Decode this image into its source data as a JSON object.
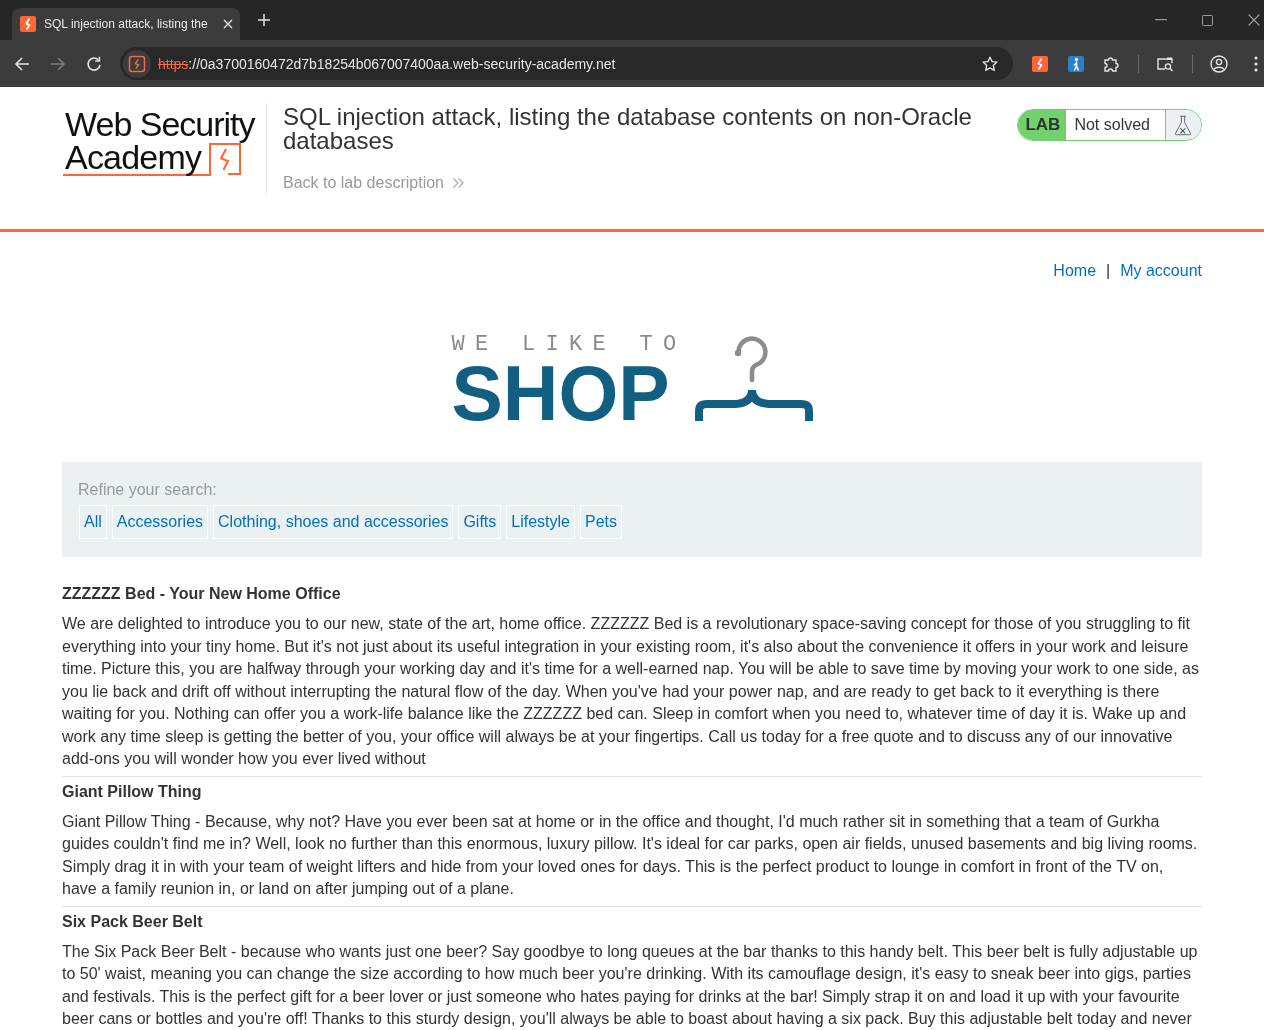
{
  "browser": {
    "tabs": [
      {
        "title": "SQL injection attack, listing the",
        "selected": true
      }
    ],
    "back_enabled": true,
    "forward_enabled": false,
    "address_bar": {
      "scheme": "https",
      "rest": "://0a3700160472d7b18254b067007400aa.web-security-academy.net",
      "not_secure": true
    }
  },
  "header": {
    "logo": {
      "line_1": "Web Security",
      "line_2": "Academy"
    },
    "lab_title": "SQL injection attack, listing the database contents on non-Oracle databases",
    "back_link": "Back to lab description",
    "lab_status": {
      "label": "LAB",
      "status": "Not solved",
      "solved": false
    }
  },
  "nav": {
    "links": [
      "Home",
      "My account"
    ],
    "separator": "|"
  },
  "shop_logo": {
    "tagline": "WE LIKE TO",
    "word": "SHOP"
  },
  "filters": {
    "label": "Refine your search:",
    "categories": [
      {
        "label": "All",
        "selected": false
      },
      {
        "label": "Accessories",
        "selected": false
      },
      {
        "label": "Clothing, shoes and accessories",
        "selected": false
      },
      {
        "label": "Gifts",
        "selected": false
      },
      {
        "label": "Lifestyle",
        "selected": false
      },
      {
        "label": "Pets",
        "selected": false
      }
    ]
  },
  "products": [
    {
      "name": "ZZZZZZ Bed - Your New Home Office",
      "description": "We are delighted to introduce you to our new, state of the art, home office. ZZZZZZ Bed is a revolutionary space-saving concept for those of you struggling to fit everything into your tiny home. But it's not just about its useful integration in your existing room, it's also about the convenience it offers in your work and leisure time. Picture this, you are halfway through your working day and it's time for a well-earned nap. You will be able to save time by moving your work to one side, as you lie back and drift off without interrupting the natural flow of the day. When you've had your power nap, and are ready to get back to it everything is there waiting for you. Nothing can offer you a work-life balance like the ZZZZZZ bed can. Sleep in comfort when you need to, whatever time of day it is. Wake up and work any time sleep is getting the better of you, your office will always be at your fingertips. Call us today for a free quote and to discuss any of our innovative add-ons you will wonder how you ever lived without"
    },
    {
      "name": "Giant Pillow Thing",
      "description": "Giant Pillow Thing - Because, why not? Have you ever been sat at home or in the office and thought, I'd much rather sit in something that a team of Gurkha guides couldn't find me in? Well, look no further than this enormous, luxury pillow. It's ideal for car parks, open air fields, unused basements and big living rooms. Simply drag it in with your team of weight lifters and hide from your loved ones for days. This is the perfect product to lounge in comfort in front of the TV on, have a family reunion in, or land on after jumping out of a plane."
    },
    {
      "name": "Six Pack Beer Belt",
      "description": "The Six Pack Beer Belt - because who wants just one beer? Say goodbye to long queues at the bar thanks to this handy belt. This beer belt is fully adjustable up to 50' waist, meaning you can change the size according to how much beer you're drinking. With its camouflage design, it's easy to sneak beer into gigs, parties and festivals. This is the perfect gift for a beer lover or just someone who hates paying for drinks at the bar! Simply strap it on and load it up with your favourite beer cans or bottles and you're off! Thanks to this sturdy design, you'll always be able to boast about having a six pack. Buy this adjustable belt today and never"
    }
  ]
}
